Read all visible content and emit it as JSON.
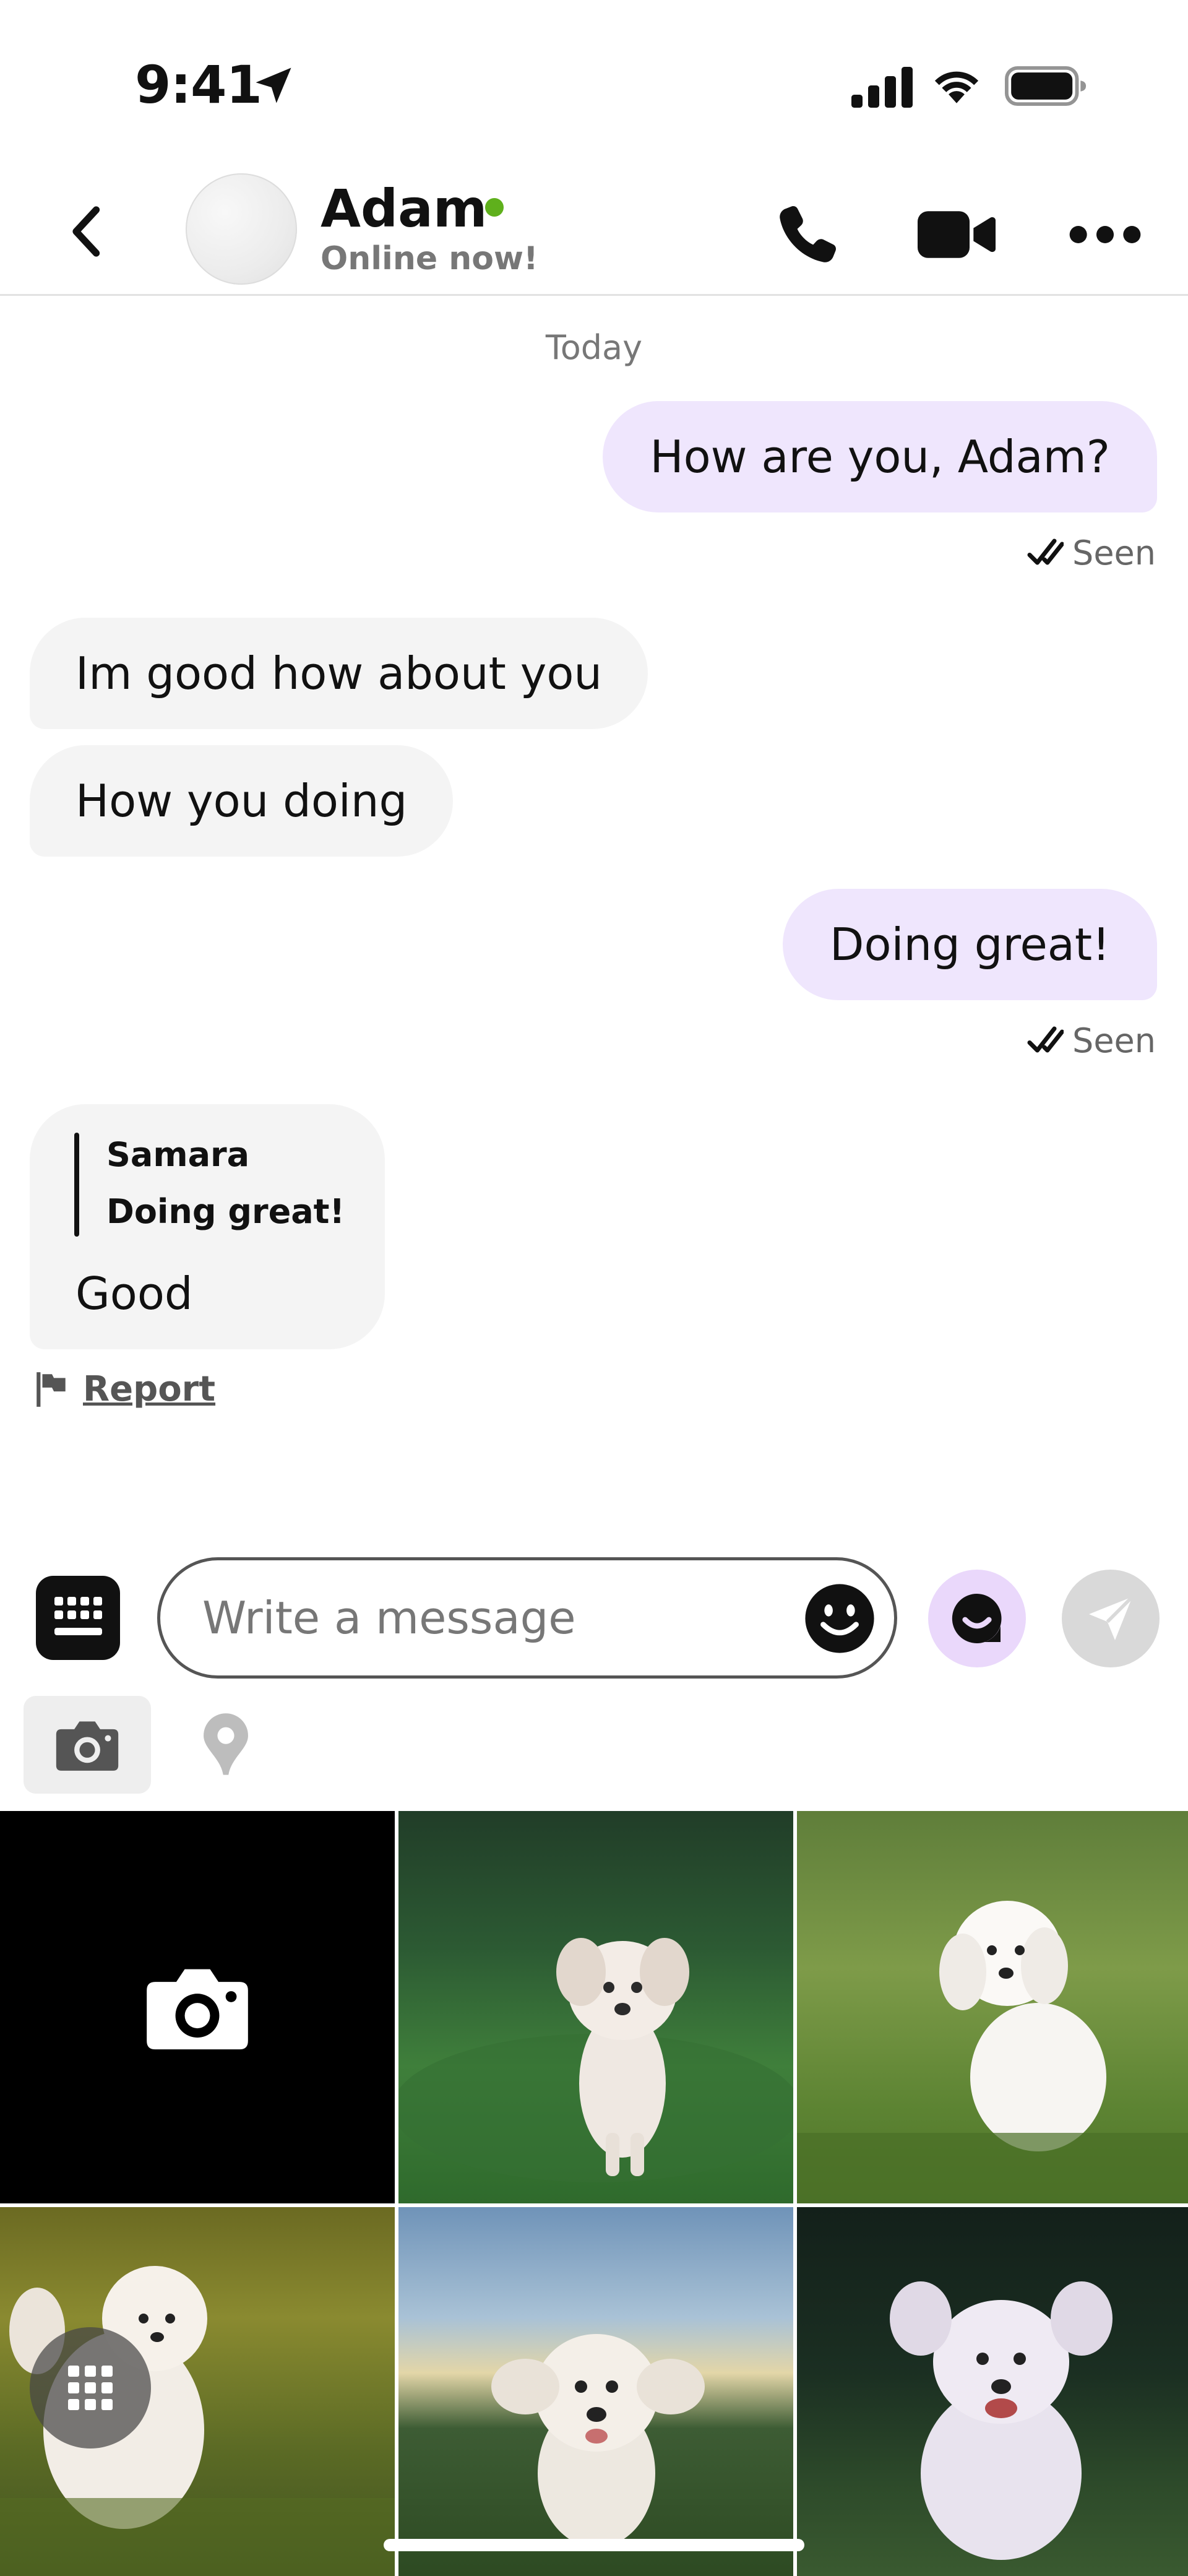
{
  "status_bar": {
    "time": "9:41"
  },
  "header": {
    "contact_name": "Adam",
    "contact_status": "Online now!"
  },
  "conversation": {
    "day_label": "Today",
    "messages": [
      {
        "direction": "outgoing",
        "text": "How are you, Adam?",
        "receipt": "Seen"
      },
      {
        "direction": "incoming",
        "text": "Im good how about you"
      },
      {
        "direction": "incoming",
        "text": "How you doing"
      },
      {
        "direction": "outgoing",
        "text": "Doing great!",
        "receipt": "Seen"
      },
      {
        "direction": "incoming",
        "reply_to": {
          "author": "Samara",
          "text": "Doing great!"
        },
        "text": "Good"
      }
    ],
    "report_label": "Report"
  },
  "composer": {
    "placeholder": "Write a message"
  },
  "icons": {
    "back": "chevron-left-icon",
    "call": "phone-icon",
    "video": "video-camera-icon",
    "more": "more-horizontal-icon",
    "seen": "double-check-icon",
    "report": "flag-icon",
    "keyboard": "keyboard-icon",
    "emoji": "smiley-icon",
    "sticker": "sticker-icon",
    "send": "send-icon",
    "camera": "camera-icon",
    "location": "location-pin-icon",
    "grid": "grid-icon"
  },
  "colors": {
    "outgoing_bubble": "#efe6fd",
    "incoming_bubble": "#f4f4f4",
    "online_dot": "#5fb01c",
    "sticker_button_bg": "#ead8fb"
  }
}
